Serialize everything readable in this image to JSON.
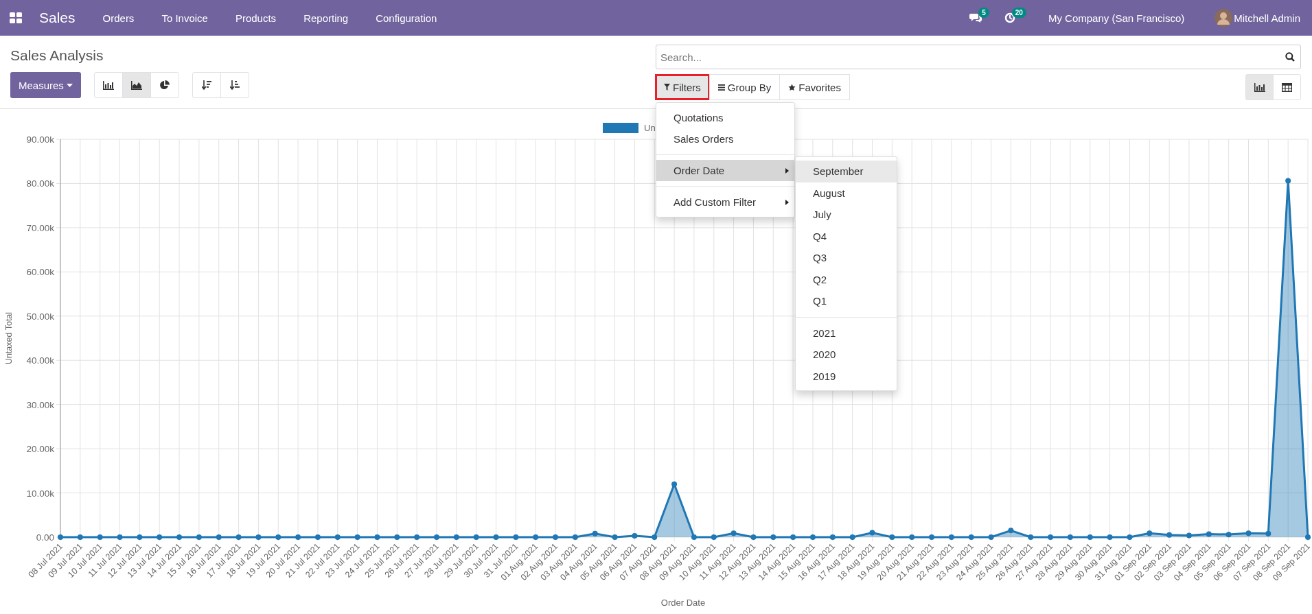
{
  "navbar": {
    "app": "Sales",
    "menu": [
      "Orders",
      "To Invoice",
      "Products",
      "Reporting",
      "Configuration"
    ],
    "messages_badge": "5",
    "activities_badge": "20",
    "company": "My Company (San Francisco)",
    "user": "Mitchell Admin"
  },
  "page_title": "Sales Analysis",
  "measures_button": "Measures",
  "chart_types": [
    {
      "kind": "bar",
      "selected": false
    },
    {
      "kind": "area",
      "selected": true
    },
    {
      "kind": "pie",
      "selected": false
    }
  ],
  "sort_buttons": [
    {
      "kind": "descending"
    },
    {
      "kind": "ascending"
    }
  ],
  "search": {
    "placeholder": "Search..."
  },
  "search_buttons": [
    {
      "kind": "filter",
      "label": "Filters",
      "selected": true,
      "outlined": true
    },
    {
      "kind": "group",
      "label": "Group By",
      "selected": false,
      "outlined": false
    },
    {
      "kind": "favorites",
      "label": "Favorites",
      "selected": false,
      "outlined": false
    }
  ],
  "views": [
    {
      "kind": "graph",
      "selected": true
    },
    {
      "kind": "pivot",
      "selected": false
    }
  ],
  "filters_menu": [
    [
      {
        "label": "Quotations",
        "submenu": false,
        "highlighted": false
      },
      {
        "label": "Sales Orders",
        "submenu": false,
        "highlighted": false
      }
    ],
    [
      {
        "label": "Order Date",
        "submenu": true,
        "highlighted": true
      }
    ],
    [
      {
        "label": "Add Custom Filter",
        "submenu": true,
        "highlighted": false
      }
    ]
  ],
  "order_date_menu": [
    [
      {
        "label": "September",
        "highlighted": true
      },
      {
        "label": "August",
        "highlighted": false
      },
      {
        "label": "July",
        "highlighted": false
      },
      {
        "label": "Q4",
        "highlighted": false
      },
      {
        "label": "Q3",
        "highlighted": false
      },
      {
        "label": "Q2",
        "highlighted": false
      },
      {
        "label": "Q1",
        "highlighted": false
      }
    ],
    [
      {
        "label": "2021",
        "highlighted": false
      },
      {
        "label": "2020",
        "highlighted": false
      },
      {
        "label": "2019",
        "highlighted": false
      }
    ]
  ],
  "chart": {
    "chart_data": {
      "type": "area",
      "grid": true,
      "xlabel": "Order Date",
      "ylabel": "Untaxed Total",
      "categories": [
        "08 Jul 2021",
        "09 Jul 2021",
        "10 Jul 2021",
        "11 Jul 2021",
        "12 Jul 2021",
        "13 Jul 2021",
        "14 Jul 2021",
        "15 Jul 2021",
        "16 Jul 2021",
        "17 Jul 2021",
        "18 Jul 2021",
        "19 Jul 2021",
        "20 Jul 2021",
        "21 Jul 2021",
        "22 Jul 2021",
        "23 Jul 2021",
        "24 Jul 2021",
        "25 Jul 2021",
        "26 Jul 2021",
        "27 Jul 2021",
        "28 Jul 2021",
        "29 Jul 2021",
        "30 Jul 2021",
        "31 Jul 2021",
        "01 Aug 2021",
        "02 Aug 2021",
        "03 Aug 2021",
        "04 Aug 2021",
        "05 Aug 2021",
        "06 Aug 2021",
        "07 Aug 2021",
        "08 Aug 2021",
        "09 Aug 2021",
        "10 Aug 2021",
        "11 Aug 2021",
        "12 Aug 2021",
        "13 Aug 2021",
        "14 Aug 2021",
        "15 Aug 2021",
        "16 Aug 2021",
        "17 Aug 2021",
        "18 Aug 2021",
        "19 Aug 2021",
        "20 Aug 2021",
        "21 Aug 2021",
        "22 Aug 2021",
        "23 Aug 2021",
        "24 Aug 2021",
        "25 Aug 2021",
        "26 Aug 2021",
        "27 Aug 2021",
        "28 Aug 2021",
        "29 Aug 2021",
        "30 Aug 2021",
        "31 Aug 2021",
        "01 Sep 2021",
        "02 Sep 2021",
        "03 Sep 2021",
        "04 Sep 2021",
        "05 Sep 2021",
        "06 Sep 2021",
        "07 Sep 2021",
        "08 Sep 2021",
        "09 Sep 2021"
      ],
      "series": [
        {
          "name": "Un",
          "color": "#1f77b4",
          "values": [
            0,
            0,
            0,
            0,
            0,
            0,
            0,
            0,
            0,
            0,
            0,
            0,
            0,
            0,
            0,
            0,
            0,
            0,
            0,
            0,
            0,
            0,
            0,
            0,
            0,
            0,
            0,
            800,
            0,
            300,
            0,
            12000,
            0,
            0,
            900,
            0,
            0,
            0,
            0,
            0,
            0,
            1000,
            0,
            0,
            0,
            0,
            0,
            0,
            1500,
            0,
            0,
            0,
            0,
            0,
            0,
            900,
            500,
            400,
            700,
            600,
            900,
            800,
            80600,
            0
          ]
        }
      ],
      "ylim": [
        0,
        90000
      ],
      "yticks": [
        {
          "value": 0,
          "label": "0.00"
        },
        {
          "value": 10000,
          "label": "10.00k"
        },
        {
          "value": 20000,
          "label": "20.00k"
        },
        {
          "value": 30000,
          "label": "30.00k"
        },
        {
          "value": 40000,
          "label": "40.00k"
        },
        {
          "value": 50000,
          "label": "50.00k"
        },
        {
          "value": 60000,
          "label": "60.00k"
        },
        {
          "value": 70000,
          "label": "70.00k"
        },
        {
          "value": 80000,
          "label": "80.00k"
        },
        {
          "value": 90000,
          "label": "90.00k"
        }
      ]
    }
  }
}
